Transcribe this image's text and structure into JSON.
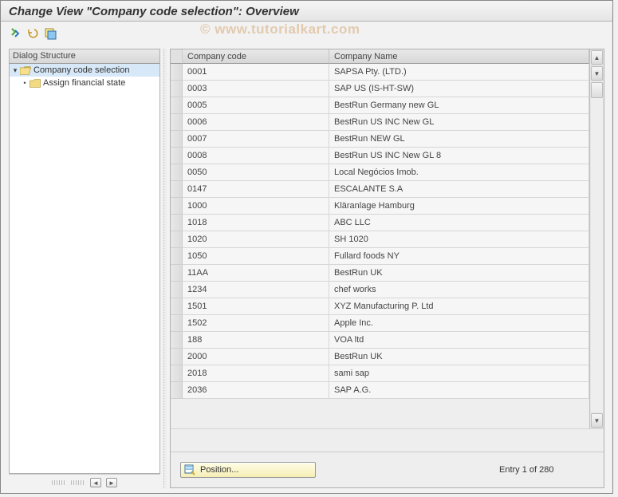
{
  "title": "Change View \"Company code selection\": Overview",
  "watermark": "© www.tutorialkart.com",
  "tree": {
    "header": "Dialog Structure",
    "items": [
      {
        "label": "Company code selection",
        "open": true,
        "selected": true
      },
      {
        "label": "Assign financial state",
        "open": false,
        "selected": false
      }
    ]
  },
  "grid": {
    "columns": {
      "code": "Company code",
      "name": "Company Name"
    },
    "rows": [
      {
        "code": "0001",
        "name": "SAPSA Pty. (LTD.)"
      },
      {
        "code": "0003",
        "name": "SAP US (IS-HT-SW)"
      },
      {
        "code": "0005",
        "name": "BestRun Germany new GL"
      },
      {
        "code": "0006",
        "name": "BestRun US INC New GL"
      },
      {
        "code": "0007",
        "name": "BestRun NEW GL"
      },
      {
        "code": "0008",
        "name": "BestRun US INC New GL 8"
      },
      {
        "code": "0050",
        "name": "Local Negócios Imob."
      },
      {
        "code": "0147",
        "name": "ESCALANTE S.A"
      },
      {
        "code": "1000",
        "name": "Kläranlage Hamburg"
      },
      {
        "code": "1018",
        "name": "ABC LLC"
      },
      {
        "code": "1020",
        "name": "SH 1020"
      },
      {
        "code": "1050",
        "name": "Fullard foods NY"
      },
      {
        "code": "11AA",
        "name": "BestRun UK"
      },
      {
        "code": "1234",
        "name": "chef works"
      },
      {
        "code": "1501",
        "name": "XYZ Manufacturing P. Ltd"
      },
      {
        "code": "1502",
        "name": "Apple Inc."
      },
      {
        "code": "188",
        "name": "VOA ltd"
      },
      {
        "code": "2000",
        "name": "BestRun UK"
      },
      {
        "code": "2018",
        "name": "sami sap"
      },
      {
        "code": "2036",
        "name": "SAP A.G."
      }
    ]
  },
  "footer": {
    "position_label": "Position...",
    "entry_text": "Entry 1 of 280"
  }
}
